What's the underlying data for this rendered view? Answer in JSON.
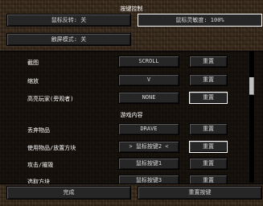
{
  "screen": {
    "title": "按键控制"
  },
  "top_buttons": {
    "mouse_invert": "鼠标反转: 关",
    "mouse_sensitivity": "鼠标灵敏度: 100%",
    "touchscreen_mode": "触屏模式: 关"
  },
  "rows": [
    {
      "label": "截图",
      "key": "SCROLL",
      "reset": "重置"
    },
    {
      "label": "缩放",
      "key": "V",
      "reset": "重置"
    },
    {
      "label": "高亮玩家(旁观者)",
      "key": "NONE",
      "reset": "重置"
    }
  ],
  "category_gameplay": "游戏内容",
  "gameplay_rows": [
    {
      "label": "丢弃物品",
      "key": "DRAVE",
      "reset": "重置"
    },
    {
      "label": "使用物品/放置方块",
      "key": "> 鼠标按键2 <",
      "reset": "重置"
    },
    {
      "label": "攻击/摧毁",
      "key": "鼠标按键1",
      "reset": "重置"
    },
    {
      "label": "选取方块",
      "key": "鼠标按键3",
      "reset": "重置"
    }
  ],
  "bottom_buttons": {
    "done": "完成",
    "reset_keys": "重置按键"
  },
  "colors": {
    "highlight": "#ffff55",
    "selected_border": "#ffffff"
  }
}
